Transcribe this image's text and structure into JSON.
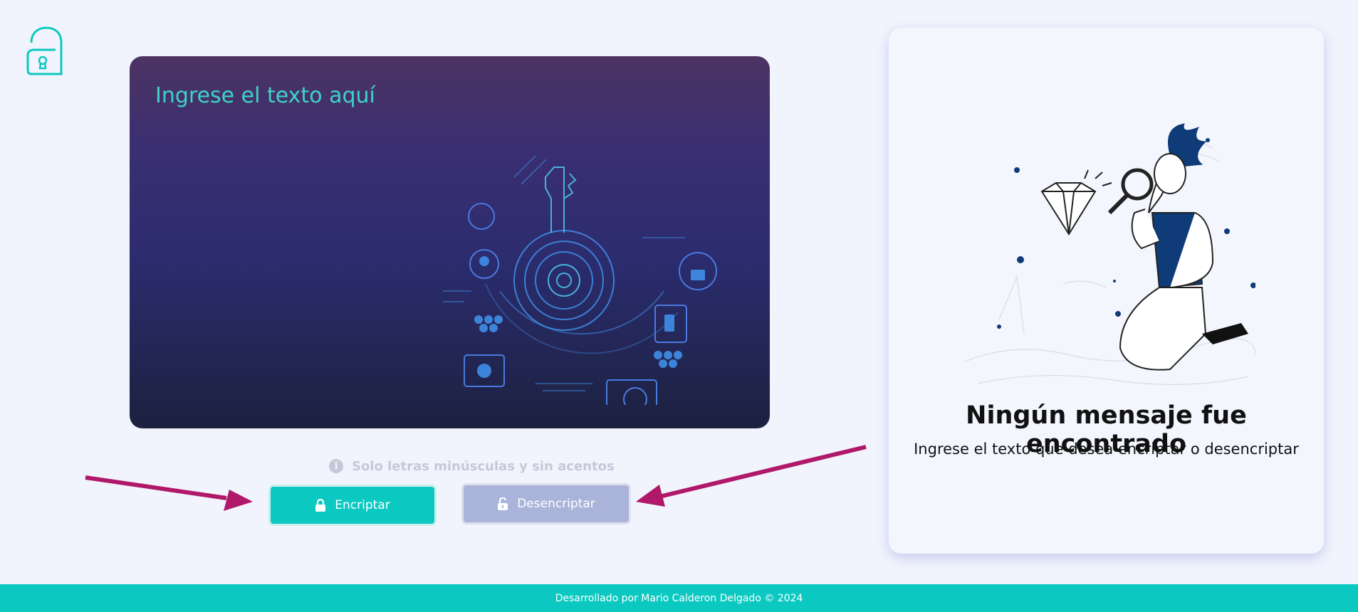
{
  "brand": {
    "logo_icon": "lock-a-logo-icon",
    "accent": "#0bc9c1"
  },
  "input": {
    "placeholder": "Ingrese el texto aquí"
  },
  "hint": {
    "icon": "info-icon",
    "text": "Solo letras minúsculas y sin acentos"
  },
  "buttons": {
    "encrypt": {
      "label": "Encriptar",
      "icon": "lock-icon",
      "color": "#0bc9c1"
    },
    "decrypt": {
      "label": "Desencriptar",
      "icon": "unlock-icon",
      "color": "#aab3d9"
    }
  },
  "output": {
    "title": "Ningún mensaje fue encontrado",
    "subtitle": "Ingrese el texto que desea encriptar o desencriptar",
    "illustration": "person-magnifier-diamond-illustration"
  },
  "annotations": {
    "arrow_color": "#b0186a"
  },
  "footer": {
    "text": "Desarrollado por Mario Calderon Delgado © 2024"
  }
}
